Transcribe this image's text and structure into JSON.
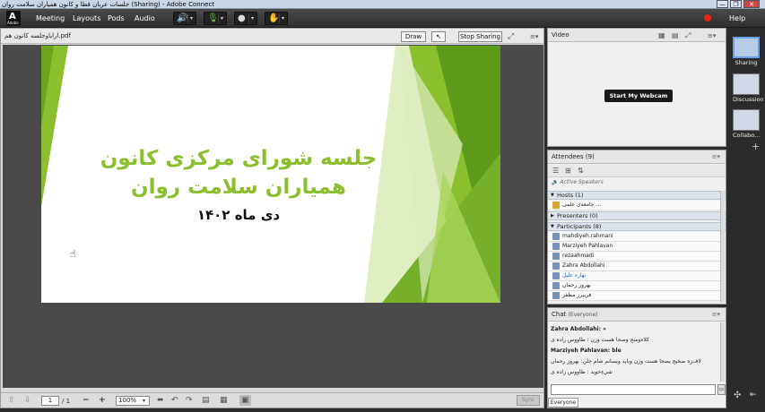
{
  "window": {
    "title": "جلسات عربان قطا و کانون همياران سلامت روان (Sharing) - Adobe Connect",
    "min": "—",
    "max": "❐",
    "close": "✕"
  },
  "menubar": {
    "logo_letter": "A",
    "logo_text": "Adobe",
    "items": [
      "Meeting",
      "Layouts",
      "Pods",
      "Audio"
    ],
    "help": "Help"
  },
  "share": {
    "filename": "اراياوجلسه كانون هم.pdf",
    "draw_label": "Draw",
    "stop_label": "Stop Sharing",
    "slide": {
      "title_line1": "جلسه شورای مرکزی کانون",
      "title_line2": "همیاران سلامت روان",
      "subtitle": "دی ماه ۱۴۰۲"
    },
    "page_current": "1",
    "page_total": "/ 1",
    "zoom": "100%",
    "sync_label": "Sync"
  },
  "video": {
    "title": "Video",
    "webcam_button": "Start My Webcam"
  },
  "attendees": {
    "title": "Attendees",
    "count": "(9)",
    "active_speakers": "Active Speakers",
    "hosts_label": "Hosts (1)",
    "host_name": "جامعه‌ی علمی ...",
    "presenters_label": "Presenters (0)",
    "participants_label": "Participants (8)",
    "participants": [
      "mahdiyeh.rahmani",
      "Marziyeh Pahlavan",
      "rezaahmadi",
      "Zahra Abdollahi",
      "بهاره عليل",
      "بهروز رحمان",
      "فريبرز مظفر"
    ]
  },
  "chat": {
    "title": "Chat",
    "scope": "(Everyone)",
    "messages": [
      "Zahra Abdollahi: «",
      "کلاه‌ومنج وصحا هست وزن : ‌‌طاووس زاده ی",
      "Marziyeh Pahlavan: ble",
      "لاف‌زه ضخيج يصحا هست وزن وبايد ويسانم شام جلن: ‌‌بهروز رحمان",
      "شي‌ءِخويد : ‌‌طاووس زاده ی"
    ],
    "recipient": "Everyone"
  },
  "layouts": {
    "items": [
      "Sharing",
      "Discussion",
      "Collabo..."
    ]
  }
}
